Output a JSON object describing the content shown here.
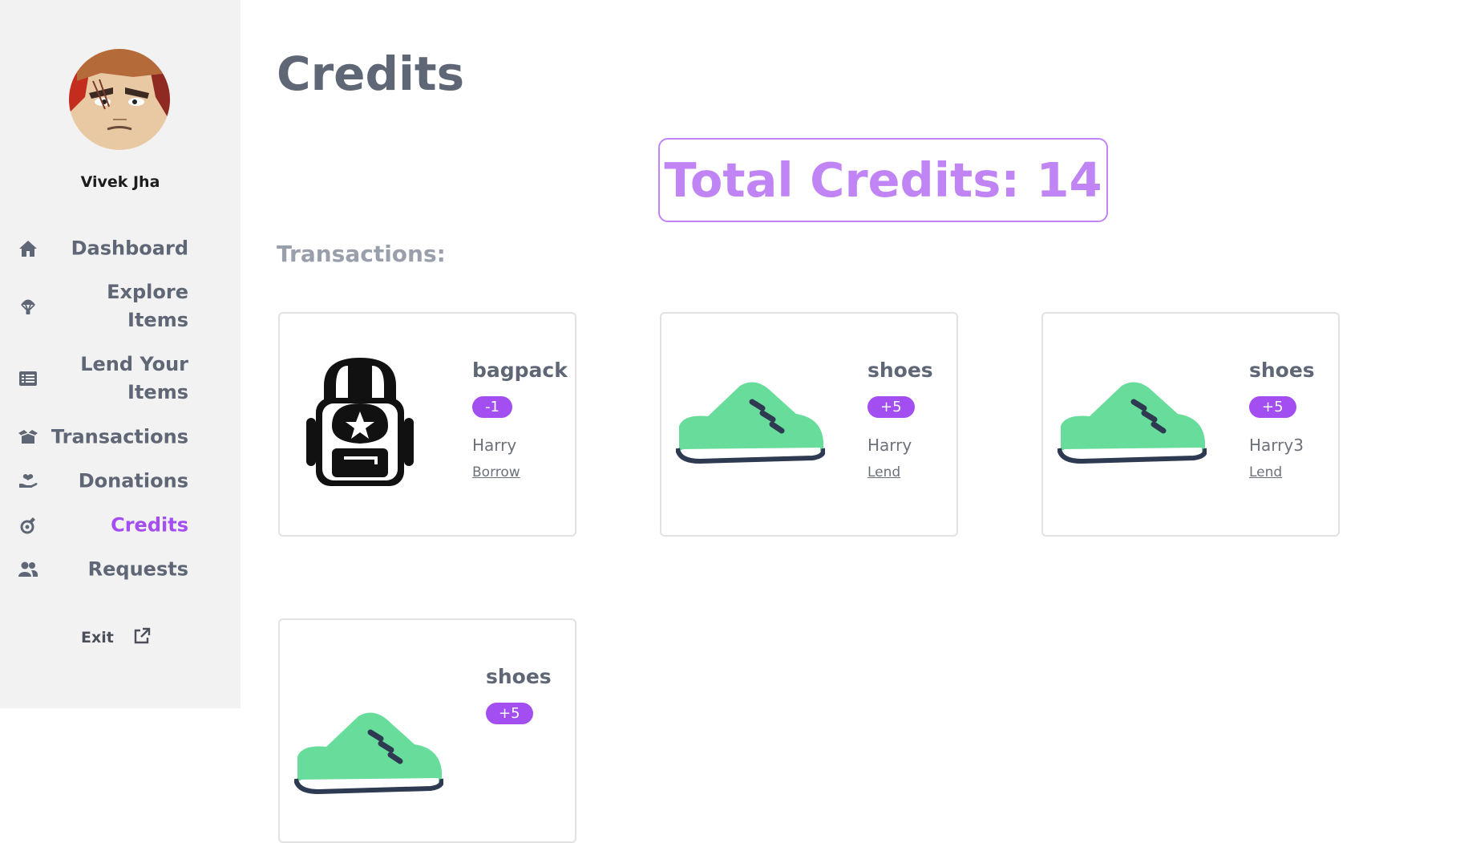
{
  "profile": {
    "name": "Vivek Jha"
  },
  "nav": [
    {
      "label": "Dashboard",
      "icon": "home-icon"
    },
    {
      "label": "Explore Items",
      "icon": "parachute-icon"
    },
    {
      "label": "Lend Your Items",
      "icon": "list-icon"
    },
    {
      "label": "Transactions",
      "icon": "box-open-icon"
    },
    {
      "label": "Donations",
      "icon": "hand-holding-heart-icon"
    },
    {
      "label": "Credits",
      "icon": "coin-icon",
      "active": true
    },
    {
      "label": "Requests",
      "icon": "users-icon"
    }
  ],
  "exit": {
    "label": "Exit",
    "icon": "external-link-icon"
  },
  "page": {
    "title": "Credits"
  },
  "total": {
    "text": "Total Credits: 14"
  },
  "transactions_heading": "Transactions:",
  "transactions": [
    {
      "name": "bagpack",
      "credit": "-1",
      "user": "Harry",
      "type": "Borrow",
      "image": "backpack-icon"
    },
    {
      "name": "shoes",
      "credit": "+5",
      "user": "Harry",
      "type": "Lend",
      "image": "shoe-icon"
    },
    {
      "name": "shoes",
      "credit": "+5",
      "user": "Harry3",
      "type": "Lend",
      "image": "shoe-icon"
    },
    {
      "name": "shoes",
      "credit": "+5",
      "user": "",
      "type": "",
      "image": "shoe-icon"
    }
  ],
  "colors": {
    "accent": "#a24ef0",
    "accent_light": "#c084f5",
    "shoe": "#68dc9a",
    "text": "#5f6776"
  }
}
